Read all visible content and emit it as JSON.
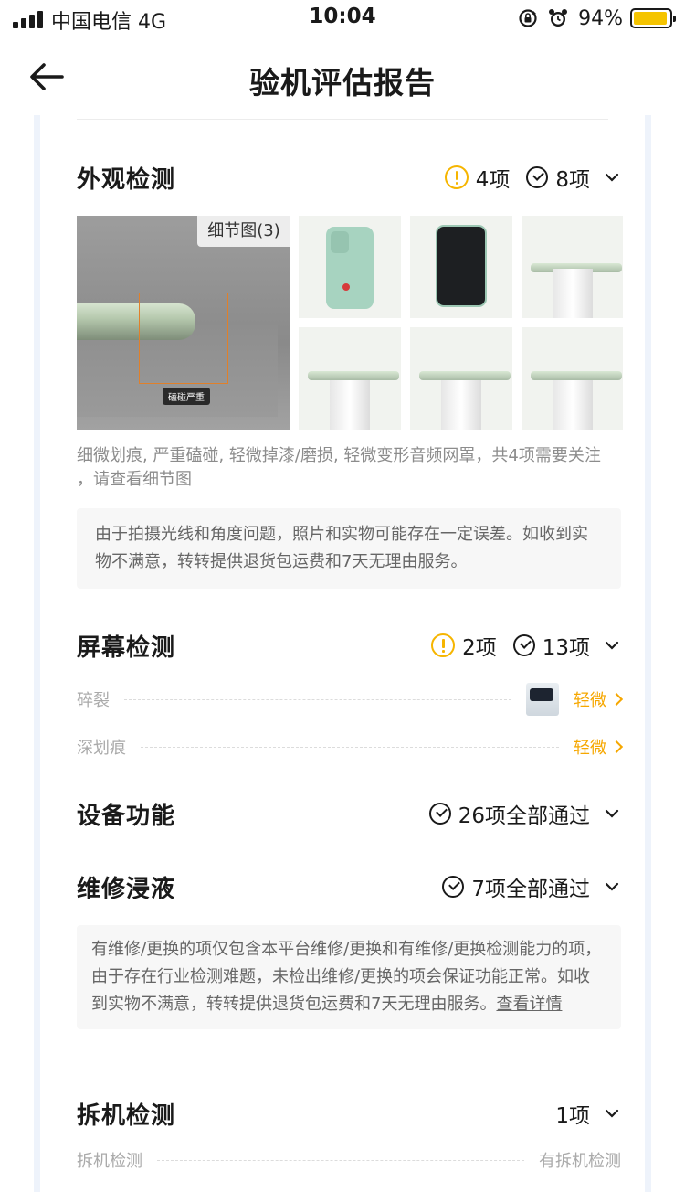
{
  "status_bar": {
    "carrier": "中国电信  4G",
    "time": "10:04",
    "battery_pct": "94%",
    "battery_level": 0.94
  },
  "nav": {
    "title": "验机评估报告"
  },
  "appearance": {
    "title": "外观检测",
    "warn_count": "4项",
    "ok_count": "8项",
    "detail_tag": "细节图(3)",
    "damage_chip": "磕碰严重",
    "description": "细微划痕, 严重磕碰, 轻微掉漆/磨损, 轻微变形音频网罩，共4项需要关注 ，请查看细节图",
    "note": "由于拍摄光线和角度问题，照片和实物可能存在一定误差。如收到实物不满意，转转提供退货包运费和7天无理由服务。"
  },
  "screen": {
    "title": "屏幕检测",
    "warn_count": "2项",
    "ok_count": "13项",
    "rows": [
      {
        "label": "碎裂",
        "value": "轻微"
      },
      {
        "label": "深划痕",
        "value": "轻微"
      }
    ]
  },
  "device": {
    "title": "设备功能",
    "ok_text": "26项全部通过"
  },
  "repair": {
    "title": "维修浸液",
    "ok_text": "7项全部通过",
    "note": "有维修/更换的项仅包含本平台维修/更换和有维修/更换检测能力的项，由于存在行业检测难题，未检出维修/更换的项会保证功能正常。如收到实物不满意，转转提供退货包运费和7天无理由服务。",
    "link": "查看详情"
  },
  "teardown": {
    "title": "拆机检测",
    "count": "1项",
    "row_label": "拆机检测",
    "row_value": "有拆机检测"
  },
  "colors": {
    "warning": "#f6b500",
    "accent_orange": "#f6a700",
    "battery": "#f5c400",
    "card_border": "#eef3fb"
  }
}
